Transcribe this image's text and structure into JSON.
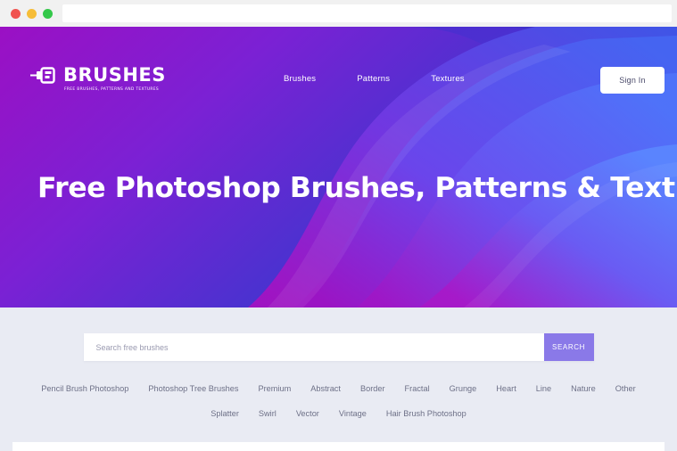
{
  "browser": {
    "traffic_lights": [
      "close-red",
      "minimize-yellow",
      "maximize-green"
    ],
    "address_value": "",
    "address_placeholder": ""
  },
  "colors": {
    "hero_purple": "#9012bd",
    "hero_magenta": "#a915c0",
    "hero_violet": "#7b35d8",
    "hero_indigo": "#4733cf",
    "hero_blue": "#3b55e0",
    "hero_bright_blue": "#4d6bf5",
    "band_background": "#e9ebf3",
    "search_button": "#8a79e8",
    "tag_text": "#6d7087",
    "signin_text": "#4a4a6a"
  },
  "header": {
    "logo": {
      "word": "BRUSHES",
      "tagline": "FREE BRUSHES, PATTERNS AND TEXTURES",
      "icon": "paintbrush-icon"
    },
    "nav": [
      {
        "label": "Brushes"
      },
      {
        "label": "Patterns"
      },
      {
        "label": "Textures"
      }
    ],
    "signin_label": "Sign In"
  },
  "hero": {
    "title": "Free Photoshop Brushes, Patterns & Textures"
  },
  "search": {
    "value": "",
    "placeholder": "Search free brushes",
    "button_label": "SEARCH"
  },
  "tags": {
    "row1": [
      {
        "label": "Pencil Brush Photoshop"
      },
      {
        "label": "Photoshop Tree Brushes"
      },
      {
        "label": "Premium"
      },
      {
        "label": "Abstract"
      },
      {
        "label": "Border"
      },
      {
        "label": "Fractal"
      },
      {
        "label": "Grunge"
      },
      {
        "label": "Heart"
      },
      {
        "label": "Line"
      },
      {
        "label": "Nature"
      },
      {
        "label": "Other"
      }
    ],
    "row2": [
      {
        "label": "Splatter"
      },
      {
        "label": "Swirl"
      },
      {
        "label": "Vector"
      },
      {
        "label": "Vintage"
      },
      {
        "label": "Hair Brush Photoshop"
      }
    ]
  }
}
